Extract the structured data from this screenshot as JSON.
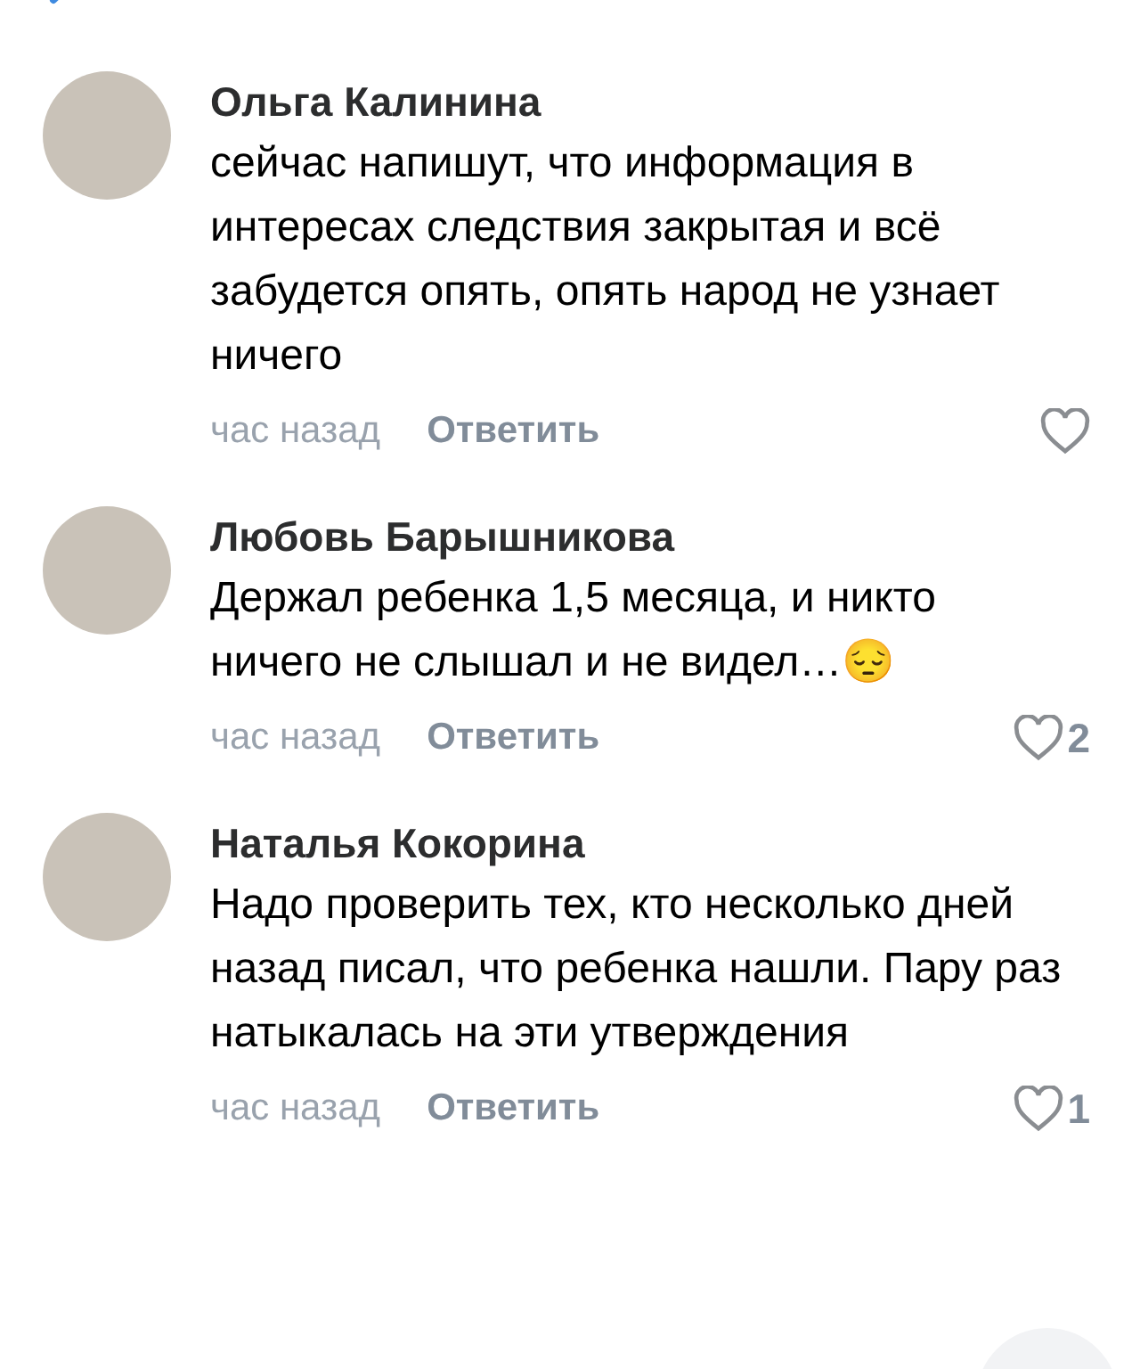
{
  "comments": [
    {
      "author": "Ольга Калинина",
      "text": "сейчас напишут, что информация в интересах следствия закрытая и всё забудется опять, опять народ не узнает ничего",
      "time": "час назад",
      "reply": "Ответить",
      "liked": false
    },
    {
      "author": "Любовь Барышникова",
      "text": "Держал ребенка 1,5 месяца, и никто ничего не слышал и не видел…😔",
      "time": "час назад",
      "reply": "Ответить",
      "liked": false,
      "likes": "2"
    },
    {
      "author": "Наталья Кокорина",
      "text": "Надо проверить тех, кто несколько дней назад писал, что ребенка нашли. Пару раз натыкалась на эти утверждения",
      "time": "час назад",
      "reply": "Ответить",
      "liked": false,
      "likes": "1"
    }
  ]
}
